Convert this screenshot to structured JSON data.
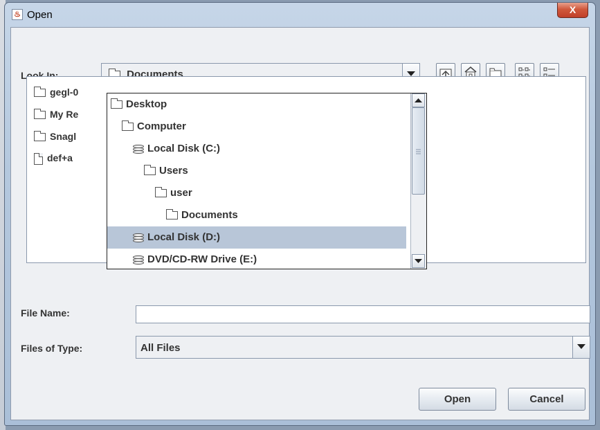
{
  "window": {
    "title": "Open",
    "close_label": "X"
  },
  "look_in": {
    "label": "Look In:",
    "selected": "Documents",
    "options": [
      {
        "label": "Desktop",
        "icon": "folder-icon",
        "indent": 0,
        "selected": false
      },
      {
        "label": "Computer",
        "icon": "folder-icon",
        "indent": 1,
        "selected": false
      },
      {
        "label": "Local Disk (C:)",
        "icon": "disk-icon",
        "indent": 2,
        "selected": false
      },
      {
        "label": "Users",
        "icon": "folder-icon",
        "indent": 3,
        "selected": false
      },
      {
        "label": "user",
        "icon": "folder-icon",
        "indent": 4,
        "selected": false
      },
      {
        "label": "Documents",
        "icon": "folder-icon",
        "indent": 5,
        "selected": false
      },
      {
        "label": "Local Disk (D:)",
        "icon": "disk-icon",
        "indent": 2,
        "selected": true
      },
      {
        "label": "DVD/CD-RW Drive (E:)",
        "icon": "disk-icon",
        "indent": 2,
        "selected": false
      }
    ]
  },
  "toolbar": {
    "buttons": [
      "up-one-level-icon",
      "home-icon",
      "new-folder-icon",
      "list-view-icon",
      "details-view-icon"
    ]
  },
  "files": [
    {
      "name": "gegl-0",
      "icon": "folder-icon"
    },
    {
      "name": "My Re",
      "icon": "folder-icon"
    },
    {
      "name": "Snagl",
      "icon": "folder-icon"
    },
    {
      "name": "def+a",
      "icon": "file-icon"
    }
  ],
  "file_name": {
    "label": "File Name:",
    "value": ""
  },
  "files_of_type": {
    "label": "Files of Type:",
    "selected": "All Files"
  },
  "buttons": {
    "open_label": "Open",
    "cancel_label": "Cancel"
  }
}
